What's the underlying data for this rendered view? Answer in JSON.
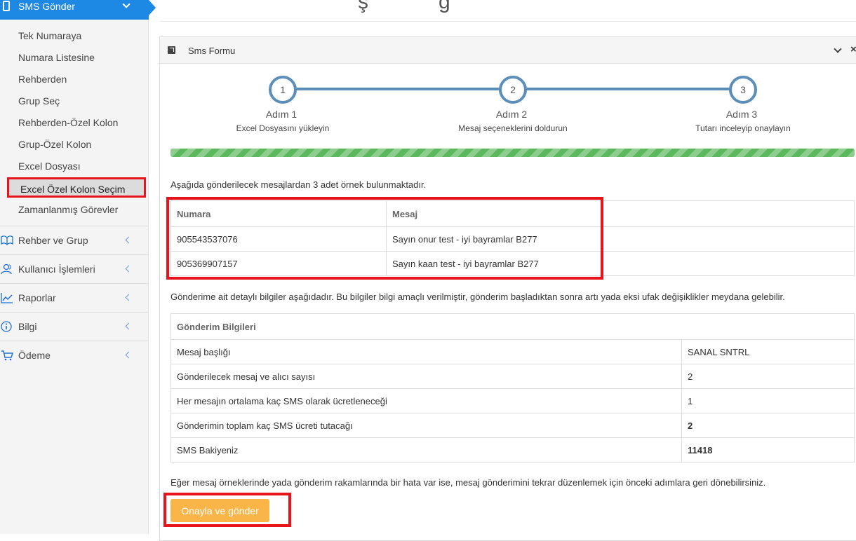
{
  "sidebar": {
    "top_item": "SMS Gönder",
    "sub_items": [
      "Tek Numaraya",
      "Numara Listesine",
      "Rehberden",
      "Grup Seç",
      "Rehberden-Özel Kolon",
      "Grup-Özel Kolon",
      "Excel Dosyası",
      "Excel Özel Kolon Seçim",
      "Zamanlanmış Görevler"
    ],
    "main_items": [
      {
        "label": "Rehber ve Grup",
        "icon": "book-icon"
      },
      {
        "label": "Kullanıcı İşlemleri",
        "icon": "users-icon"
      },
      {
        "label": "Raporlar",
        "icon": "chart-icon"
      },
      {
        "label": "Bilgi",
        "icon": "info-icon"
      },
      {
        "label": "Ödeme",
        "icon": "cart-icon"
      }
    ]
  },
  "page_title_fragment": "ş            g",
  "panel": {
    "title": "Sms Formu",
    "close_glyph": "×"
  },
  "wizard": {
    "steps": [
      {
        "number": "1",
        "title": "Adım 1",
        "subtitle": "Excel Dosyasını yükleyin"
      },
      {
        "number": "2",
        "title": "Adım 2",
        "subtitle": "Mesaj seçeneklerini doldurun"
      },
      {
        "number": "3",
        "title": "Adım 3",
        "subtitle": "Tutarı inceleyip onaylayın"
      }
    ],
    "progress": 1.0
  },
  "samples": {
    "intro": "Aşağıda gönderilecek mesajlardan 3 adet örnek bulunmaktadır.",
    "headers": [
      "Numara",
      "Mesaj"
    ],
    "rows": [
      [
        "905543537076",
        "Sayın onur test - iyi bayramlar B277"
      ],
      [
        "905369907157",
        "Sayın kaan test - iyi bayramlar B277"
      ]
    ]
  },
  "details": {
    "intro": "Gönderime ait detaylı bilgiler aşağıdadır. Bu bilgiler bilgi amaçlı verilmiştir, gönderim başladıktan sonra artı yada eksi ufak değişiklikler meydana gelebilir.",
    "header": "Gönderim Bilgileri",
    "rows": [
      [
        "Mesaj başlığı",
        "SANAL SNTRL"
      ],
      [
        "Gönderilecek mesaj ve alıcı sayısı",
        "2"
      ],
      [
        "Her mesajın ortalama kaç SMS olarak ücretleneceği",
        "1"
      ],
      [
        "Gönderimin toplam kaç SMS ücreti tutacağı",
        "2"
      ],
      [
        "SMS Bakiyeniz",
        "11418"
      ]
    ]
  },
  "footer_note": "Eğer mesaj örneklerinde yada gönderim rakamlarında bir hata var ise, mesaj gönderimini tekrar düzenlemek için önceki adımlara geri dönebilirsiniz.",
  "confirm_button": "Onayla ve gönder",
  "colors": {
    "sidebar_active": "#1e88e5",
    "highlight_red": "#e8141b",
    "wizard_blue": "#5b8fb9",
    "progress_green": "#5cb85c",
    "button_orange": "#f9b548"
  }
}
